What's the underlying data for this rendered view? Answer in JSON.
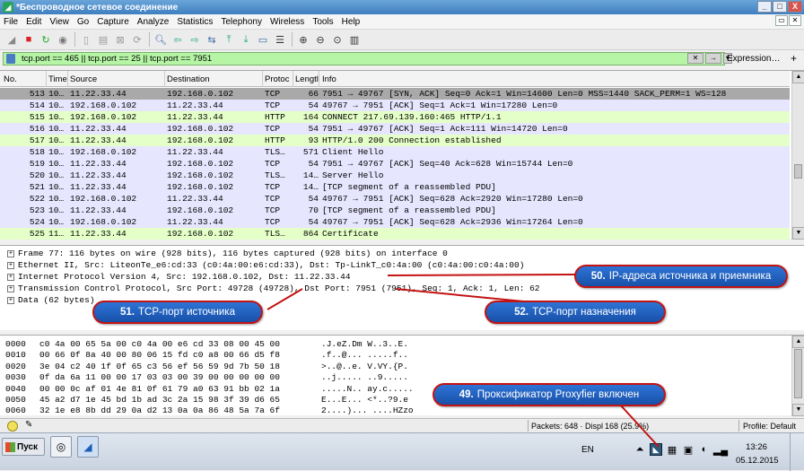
{
  "window": {
    "title": "*Беспроводное сетевое соединение",
    "min": "_",
    "max": "□",
    "close": "X"
  },
  "menu": {
    "items": [
      "File",
      "Edit",
      "View",
      "Go",
      "Capture",
      "Analyze",
      "Statistics",
      "Telephony",
      "Wireless",
      "Tools",
      "Help"
    ]
  },
  "filter": {
    "value": "tcp.port == 465 || tcp.port == 25 || tcp.port == 7951",
    "expression_label": "Expression…",
    "plus": "+"
  },
  "packet_list": {
    "columns": [
      "No.",
      "Time",
      "Source",
      "Destination",
      "Protocol",
      "Length",
      "Info"
    ],
    "column_headers_shown": [
      "No.",
      "Time",
      "Source",
      "Destination",
      "Protoc",
      "Lengtl",
      "Info"
    ],
    "rows": [
      {
        "no": "513",
        "time": "10…",
        "src": "11.22.33.44",
        "dst": "192.168.0.102",
        "proto": "TCP",
        "len": "66",
        "info": "7951 → 49767 [SYN, ACK] Seq=0 Ack=1 Win=14600 Len=0 MSS=1440 SACK_PERM=1 WS=128",
        "bg": "#a9a9a9"
      },
      {
        "no": "514",
        "time": "10…",
        "src": "192.168.0.102",
        "dst": "11.22.33.44",
        "proto": "TCP",
        "len": "54",
        "info": "49767 → 7951 [ACK] Seq=1 Ack=1 Win=17280 Len=0",
        "bg": "#e7e6ff"
      },
      {
        "no": "515",
        "time": "10…",
        "src": "192.168.0.102",
        "dst": "11.22.33.44",
        "proto": "HTTP",
        "len": "164",
        "info": "CONNECT 217.69.139.160:465 HTTP/1.1",
        "bg": "#e4ffc7"
      },
      {
        "no": "516",
        "time": "10…",
        "src": "11.22.33.44",
        "dst": "192.168.0.102",
        "proto": "TCP",
        "len": "54",
        "info": "7951 → 49767 [ACK] Seq=1 Ack=111 Win=14720 Len=0",
        "bg": "#e7e6ff"
      },
      {
        "no": "517",
        "time": "10…",
        "src": "11.22.33.44",
        "dst": "192.168.0.102",
        "proto": "HTTP",
        "len": "93",
        "info": "HTTP/1.0 200 Connection established",
        "bg": "#e4ffc7"
      },
      {
        "no": "518",
        "time": "10…",
        "src": "192.168.0.102",
        "dst": "11.22.33.44",
        "proto": "TLS…",
        "len": "571",
        "info": "Client Hello",
        "bg": "#e7e6ff"
      },
      {
        "no": "519",
        "time": "10…",
        "src": "11.22.33.44",
        "dst": "192.168.0.102",
        "proto": "TCP",
        "len": "54",
        "info": "7951 → 49767 [ACK] Seq=40 Ack=628 Win=15744 Len=0",
        "bg": "#e7e6ff"
      },
      {
        "no": "520",
        "time": "10…",
        "src": "11.22.33.44",
        "dst": "192.168.0.102",
        "proto": "TLS…",
        "len": "14…",
        "info": "Server Hello",
        "bg": "#e7e6ff"
      },
      {
        "no": "521",
        "time": "10…",
        "src": "11.22.33.44",
        "dst": "192.168.0.102",
        "proto": "TCP",
        "len": "14…",
        "info": "[TCP segment of a reassembled PDU]",
        "bg": "#e7e6ff"
      },
      {
        "no": "522",
        "time": "10…",
        "src": "192.168.0.102",
        "dst": "11.22.33.44",
        "proto": "TCP",
        "len": "54",
        "info": "49767 → 7951 [ACK] Seq=628 Ack=2920 Win=17280 Len=0",
        "bg": "#e7e6ff"
      },
      {
        "no": "523",
        "time": "10…",
        "src": "11.22.33.44",
        "dst": "192.168.0.102",
        "proto": "TCP",
        "len": "70",
        "info": "[TCP segment of a reassembled PDU]",
        "bg": "#e7e6ff"
      },
      {
        "no": "524",
        "time": "10…",
        "src": "192.168.0.102",
        "dst": "11.22.33.44",
        "proto": "TCP",
        "len": "54",
        "info": "49767 → 7951 [ACK] Seq=628 Ack=2936 Win=17264 Len=0",
        "bg": "#e7e6ff"
      },
      {
        "no": "525",
        "time": "11…",
        "src": "11.22.33.44",
        "dst": "192.168.0.102",
        "proto": "TLS…",
        "len": "864",
        "info": "Certificate",
        "bg": "#e4ffc7"
      }
    ]
  },
  "details": [
    "Frame 77: 116 bytes on wire (928 bits), 116 bytes captured (928 bits) on interface 0",
    "Ethernet II, Src: LiteonTe_e6:cd:33 (c0:4a:00:e6:cd:33), Dst: Tp-LinkT_c0:4a:00 (c0:4a:00:c0:4a:00)",
    "Internet Protocol Version 4, Src: 192.168.0.102, Dst: 11.22.33.44",
    "Transmission Control Protocol, Src Port: 49728 (49728), Dst Port: 7951 (7951), Seq: 1, Ack: 1, Len: 62",
    "Data (62 bytes)"
  ],
  "bytes": [
    {
      "off": "0000",
      "hex": "c0 4a 00 65 5a 00 c0 4a  00 e6 cd 33 08 00 45 00",
      "ascii": ".J.eZ.Dm W..3..E."
    },
    {
      "off": "0010",
      "hex": "00 66 0f 8a 40 00 80 06  15 fd c0 a8 00 66 d5 f8",
      "ascii": ".f..@... .....f.."
    },
    {
      "off": "0020",
      "hex": "3e 04 c2 40 1f 0f 65 c3  56 ef 56 59 9d 7b 50 18",
      "ascii": ">..@..e. V.VY.{P."
    },
    {
      "off": "0030",
      "hex": "0f da 6a 11 00 00 17 03  03 00 39 00 00 00 00 00",
      "ascii": "..j..... ..9....."
    },
    {
      "off": "0040",
      "hex": "00 00 0c af 01 4e 81 0f  61 79 a0 63 91 bb 02 1a",
      "ascii": ".....N.. ay.c....."
    },
    {
      "off": "0050",
      "hex": "45 a2 d7 1e 45 bd 1b ad  3c 2a 15 98 3f 39 d6 65",
      "ascii": "E...E... <*..?9.e"
    },
    {
      "off": "0060",
      "hex": "32 1e e8 8b dd 29 0a d2  13 0a 0a 86 48 5a 7a 6f",
      "ascii": "2....)... ....HZzo"
    }
  ],
  "status": {
    "packets": "Packets: 648 · Displ",
    "displayed": "168 (25.9%)",
    "profile": "Profile: Default"
  },
  "taskbar": {
    "start_label": "Пуск",
    "language": "EN",
    "time": "13:26",
    "date": "05.12.2015"
  },
  "annotations": {
    "a50_num": "50.",
    "a50_text": "IP-адреса источника и приемника",
    "a51_num": "51.",
    "a51_text": "TCP-порт источника",
    "a52_num": "52.",
    "a52_text": "TCP-порт назначения",
    "a49_num": "49.",
    "a49_text": "Проксификатор Proxyfier включен"
  },
  "colors": {
    "filter_bg": "#b5f5a5",
    "callout_bg": "#1e5fc0",
    "callout_border": "#c31313",
    "selected_row": "#a9a9a9"
  }
}
